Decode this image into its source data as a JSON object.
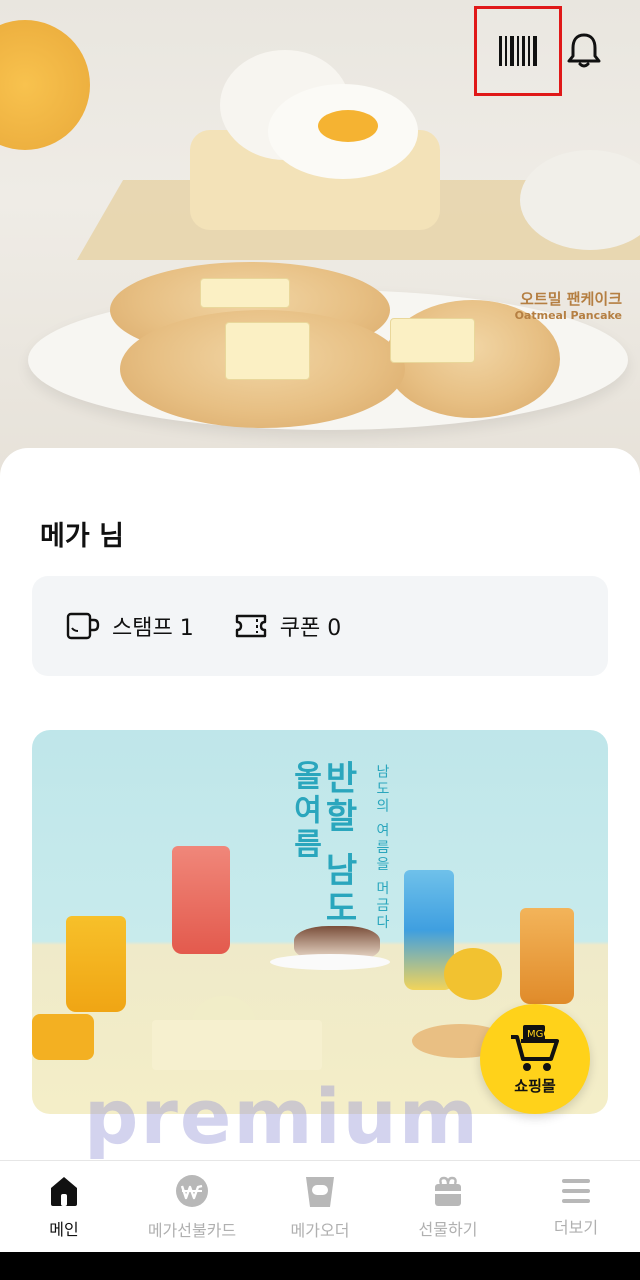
{
  "hero": {
    "product_label_ko": "오트밀 팬케이크",
    "product_label_en": "Oatmeal Pancake",
    "barcode_icon": "barcode-icon",
    "bell_icon": "bell-icon"
  },
  "user": {
    "greeting": "메가 님"
  },
  "rewards": {
    "stamp_label": "스탬프 1",
    "stamp_icon": "cup-icon",
    "coupon_label": "쿠폰 0",
    "coupon_icon": "ticket-icon"
  },
  "banner": {
    "title_line1": "반할 남도",
    "title_line2": "올여름",
    "subtitle": "남도의 여름을 머금다"
  },
  "shop_fab": {
    "label": "쇼핑몰",
    "icon": "cart-icon"
  },
  "watermark": "premium",
  "nav": {
    "items": [
      {
        "label": "메인",
        "icon": "home-icon",
        "active": true
      },
      {
        "label": "메가선불카드",
        "icon": "won-coin-icon",
        "active": false
      },
      {
        "label": "메가오더",
        "icon": "cup-order-icon",
        "active": false
      },
      {
        "label": "선물하기",
        "icon": "gift-icon",
        "active": false
      },
      {
        "label": "더보기",
        "icon": "menu-icon",
        "active": false
      }
    ]
  },
  "colors": {
    "accent_yellow": "#ffd21a",
    "highlight_red": "#e01818",
    "nav_inactive": "#b0b0b0",
    "card_bg": "#f3f5f7"
  }
}
